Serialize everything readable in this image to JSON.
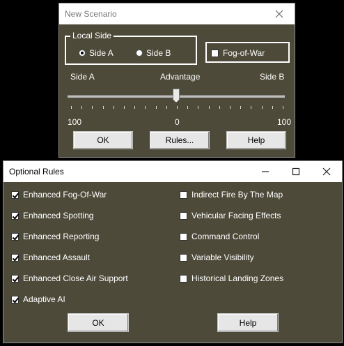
{
  "new_scenario": {
    "title": "New Scenario",
    "local_side": {
      "legend": "Local Side",
      "options": [
        {
          "label": "Side A",
          "selected": true
        },
        {
          "label": "Side B",
          "selected": false
        }
      ]
    },
    "fog_of_war": {
      "label": "Fog-of-War",
      "checked": false
    },
    "slider": {
      "left_label": "Side A",
      "center_label": "Advantage",
      "right_label": "Side B",
      "min_label": "100",
      "mid_label": "0",
      "max_label": "100",
      "value_fraction": 0.5
    },
    "buttons": {
      "ok": "OK",
      "rules": "Rules...",
      "help": "Help"
    }
  },
  "optional_rules": {
    "title": "Optional Rules",
    "left_rules": [
      {
        "label": "Enhanced Fog-Of-War",
        "checked": true
      },
      {
        "label": "Enhanced Spotting",
        "checked": true
      },
      {
        "label": "Enhanced Reporting",
        "checked": true
      },
      {
        "label": "Enhanced Assault",
        "checked": true
      },
      {
        "label": "Enhanced Close Air Support",
        "checked": true
      },
      {
        "label": "Adaptive AI",
        "checked": true
      }
    ],
    "right_rules": [
      {
        "label": "Indirect Fire By The Map",
        "checked": false
      },
      {
        "label": "Vehicular Facing Effects",
        "checked": false
      },
      {
        "label": "Command Control",
        "checked": false
      },
      {
        "label": "Variable Visibility",
        "checked": false
      },
      {
        "label": "Historical Landing Zones",
        "checked": false
      }
    ],
    "buttons": {
      "ok": "OK",
      "help": "Help"
    }
  },
  "colors": {
    "dialog_bg": "#4d4a39",
    "titlebar_bg": "#ffffff",
    "text": "#ffffff"
  }
}
